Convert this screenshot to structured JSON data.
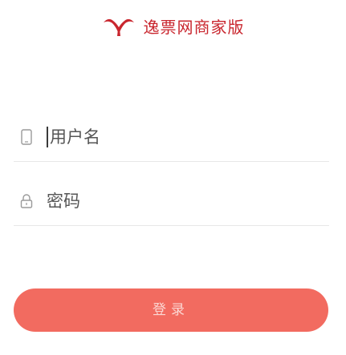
{
  "brand": {
    "logo_icon": "red-bird-logo",
    "title": "逸票网商家版",
    "color": "#c9262e"
  },
  "login_form": {
    "username": {
      "icon": "phone-icon",
      "placeholder": "用户名",
      "value": ""
    },
    "password": {
      "icon": "lock-icon",
      "placeholder": "密码",
      "value": ""
    },
    "submit_label": "登录",
    "submit_color": "#f26b60"
  }
}
